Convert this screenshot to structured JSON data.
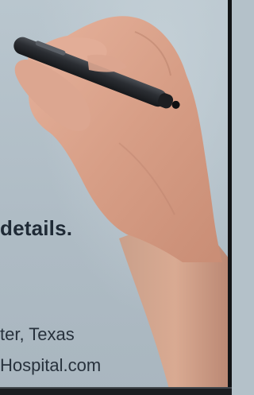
{
  "colors": {
    "background": "#b4c1c9",
    "text": "#1f2a36",
    "skin": "#d9a38c",
    "pen": "#2a2d31"
  },
  "image": {
    "subject": "hand-holding-pen"
  },
  "text": {
    "headline": "details.",
    "location_line": "ter, Texas",
    "website_line": "Hospital.com"
  }
}
